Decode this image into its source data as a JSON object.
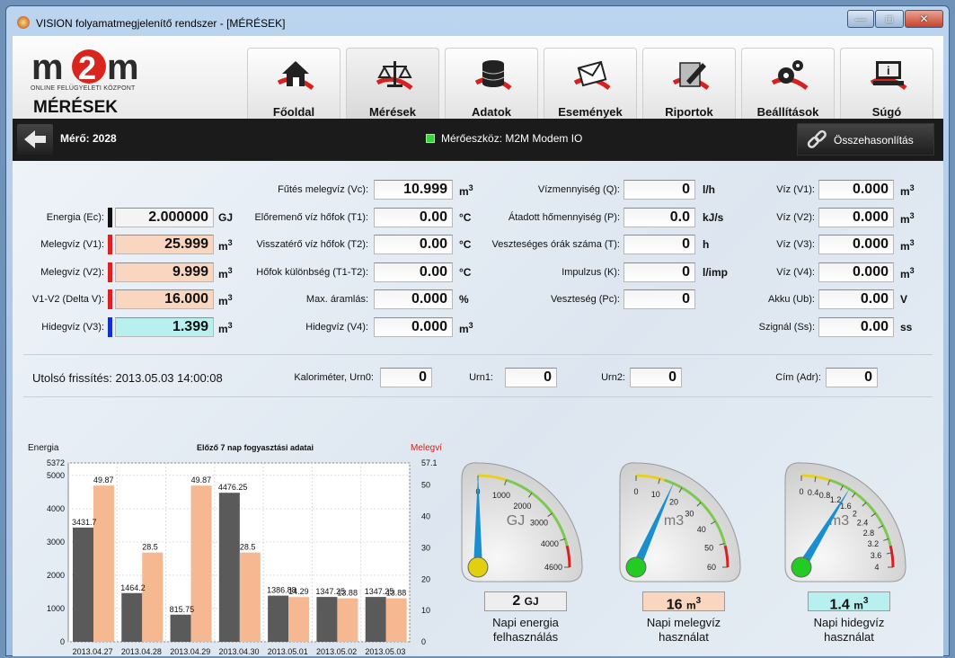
{
  "window": {
    "title": "VISION folyamatmegjelenítő rendszer - [MÉRÉSEK]"
  },
  "logo": {
    "text": "m2m",
    "subtitle": "ONLINE FELÜGYELETI KÖZPONT"
  },
  "page_title": "MÉRÉSEK",
  "nav": [
    {
      "label": "Főoldal",
      "icon": "home-icon"
    },
    {
      "label": "Mérések",
      "icon": "scale-icon",
      "active": true
    },
    {
      "label": "Adatok",
      "icon": "database-icon"
    },
    {
      "label": "Események",
      "icon": "envelope-icon"
    },
    {
      "label": "Riportok",
      "icon": "report-icon"
    },
    {
      "label": "Beállítások",
      "icon": "gears-icon"
    },
    {
      "label": "Súgó",
      "icon": "help-icon"
    }
  ],
  "toolbar": {
    "meter": "Mérő: 2028",
    "device": "Mérőeszköz:  M2M Modem IO",
    "compare": "Összehasonlítás"
  },
  "fields": {
    "col1": [
      {
        "label": "Energia (Ec):",
        "value": "2.000000",
        "unit": "GJ",
        "color": "#111111",
        "bg": "#f4f4f4"
      },
      {
        "label": "Melegvíz (V1):",
        "value": "25.999",
        "unit": "m",
        "sup": "3",
        "color": "#e02020",
        "bg": "#f8d6c0"
      },
      {
        "label": "Melegvíz (V2):",
        "value": "9.999",
        "unit": "m",
        "sup": "3",
        "color": "#e02020",
        "bg": "#f8d6c0"
      },
      {
        "label": "V1-V2 (Delta V):",
        "value": "16.000",
        "unit": "m",
        "sup": "3",
        "color": "#e02020",
        "bg": "#f8d6c0"
      },
      {
        "label": "Hidegvíz (V3):",
        "value": "1.399",
        "unit": "m",
        "sup": "3",
        "color": "#1030d0",
        "bg": "#b8f0f0"
      }
    ],
    "col2": [
      {
        "label": "Fűtés melegvíz (Vc):",
        "value": "10.999",
        "unit": "m",
        "sup": "3"
      },
      {
        "label": "Előremenő víz hőfok (T1):",
        "value": "0.00",
        "unit": "°C"
      },
      {
        "label": "Visszatérő víz hőfok (T2):",
        "value": "0.00",
        "unit": "°C"
      },
      {
        "label": "Hőfok különbség (T1-T2):",
        "value": "0.00",
        "unit": "°C"
      },
      {
        "label": "Max. áramlás:",
        "value": "0.000",
        "unit": "%"
      },
      {
        "label": "Hidegvíz (V4):",
        "value": "0.000",
        "unit": "m",
        "sup": "3"
      }
    ],
    "col3": [
      {
        "label": "Vízmennyiség (Q):",
        "value": "0",
        "unit": "l/h"
      },
      {
        "label": "Átadott hőmennyiség (P):",
        "value": "0.0",
        "unit": "kJ/s"
      },
      {
        "label": "Veszteséges órák száma (T):",
        "value": "0",
        "unit": "h"
      },
      {
        "label": "Impulzus (K):",
        "value": "0",
        "unit": "l/imp"
      },
      {
        "label": "Veszteség (Pc):",
        "value": "0",
        "unit": ""
      }
    ],
    "col4": [
      {
        "label": "Víz (V1):",
        "value": "0.000",
        "unit": "m",
        "sup": "3"
      },
      {
        "label": "Víz (V2):",
        "value": "0.000",
        "unit": "m",
        "sup": "3"
      },
      {
        "label": "Víz (V3):",
        "value": "0.000",
        "unit": "m",
        "sup": "3"
      },
      {
        "label": "Víz (V4):",
        "value": "0.000",
        "unit": "m",
        "sup": "3"
      },
      {
        "label": "Akku (Ub):",
        "value": "0.00",
        "unit": "V"
      },
      {
        "label": "Szignál (Ss):",
        "value": "0.00",
        "unit": "ss"
      }
    ]
  },
  "status": {
    "last_refresh": "Utolsó frissítés: 2013.05.03 14:00:08",
    "urn0_label": "Kaloriméter, Urn0:",
    "urn0": "0",
    "urn1_label": "Urn1:",
    "urn1": "0",
    "urn2_label": "Urn2:",
    "urn2": "0",
    "adr_label": "Cím (Adr):",
    "adr": "0"
  },
  "chart_data": {
    "type": "bar",
    "title": "Előző 7 nap fogyasztási adatai",
    "categories": [
      "2013.04.27",
      "2013.04.28",
      "2013.04.29",
      "2013.04.30",
      "2013.05.01",
      "2013.05.02",
      "2013.05.03"
    ],
    "series": [
      {
        "name": "Energia",
        "values": [
          3431.7,
          1464.2,
          815.75,
          4476.25,
          1386.88,
          1347.25,
          1347.25
        ],
        "labels": [
          "3431.7",
          "1464.2",
          "815.75",
          "4476.25",
          "1386.88",
          "1347.25",
          "1347.25"
        ],
        "color": "#555555"
      },
      {
        "name": "Melegvíz",
        "values": [
          49.87,
          28.5,
          49.87,
          28.5,
          14.29,
          13.88,
          13.88
        ],
        "labels": [
          "49.87",
          "28.5",
          "49.87",
          "28.5",
          "14.29",
          "13.88",
          "13.88"
        ],
        "color": "#f5b38a"
      }
    ],
    "ylabel_left": "Energia",
    "ylabel_right": "Melegvíz",
    "ylim_left": [
      0,
      5372
    ],
    "ylim_right": [
      0,
      57.1
    ],
    "yticks_left": [
      "5372",
      "5000",
      "4000",
      "3000",
      "2000",
      "1000",
      "0"
    ],
    "yticks_right": [
      "57.1",
      "50",
      "40",
      "30",
      "20",
      "10",
      "0"
    ],
    "grid": true
  },
  "gauges": [
    {
      "unit": "GJ",
      "min": 0,
      "max": 4600,
      "value": 2,
      "ticks": [
        "0",
        "1000",
        "2000",
        "3000",
        "4000",
        "4600"
      ],
      "display": "2",
      "display_unit": "GJ",
      "label1": "Napi energia",
      "label2": "felhasználás",
      "bg": "#eeeeee",
      "knob": "#e0d010"
    },
    {
      "unit": "m3",
      "min": 0,
      "max": 60,
      "value": 16,
      "ticks": [
        "0",
        "10",
        "20",
        "30",
        "40",
        "50",
        "60"
      ],
      "display": "16",
      "display_unit": "m",
      "display_sup": "3",
      "label1": "Napi melegvíz",
      "label2": "használat",
      "bg": "#f8d6c0",
      "knob": "#22cc22"
    },
    {
      "unit": "m3",
      "min": 0,
      "max": 4,
      "value": 1.4,
      "ticks": [
        "0",
        "0.4",
        "0.8",
        "1.2",
        "1.6",
        "2",
        "2.4",
        "2.8",
        "3.2",
        "3.6",
        "4"
      ],
      "display": "1.4",
      "display_unit": "m",
      "display_sup": "3",
      "label1": "Napi hidegvíz",
      "label2": "használat",
      "bg": "#b8f0f0",
      "knob": "#22cc22"
    }
  ]
}
